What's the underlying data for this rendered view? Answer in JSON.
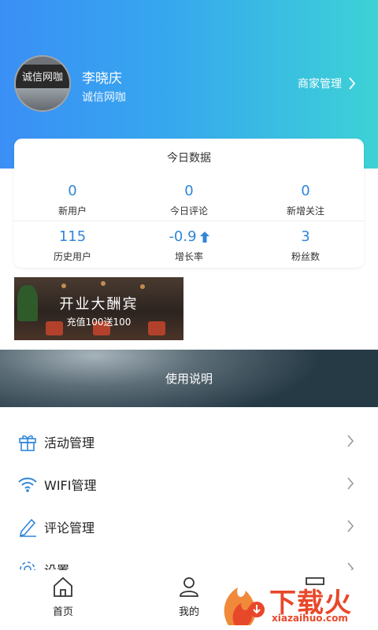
{
  "profile": {
    "name": "李晓庆",
    "shop": "诚信网咖",
    "avatar_sign_text": "诚信网咖",
    "merchant_link": "商家管理"
  },
  "today_data": {
    "title": "今日数据",
    "stats": [
      {
        "value": "0",
        "label": "新用户"
      },
      {
        "value": "0",
        "label": "今日评论"
      },
      {
        "value": "0",
        "label": "新增关注"
      },
      {
        "value": "115",
        "label": "历史用户"
      },
      {
        "value": "-0.9",
        "label": "增长率",
        "icon": "arrow-up-icon"
      },
      {
        "value": "3",
        "label": "粉丝数"
      }
    ]
  },
  "promo": {
    "title": "开业大酬宾",
    "subtitle": "充值100送100"
  },
  "instructions": {
    "label": "使用说明"
  },
  "menu": [
    {
      "label": "活动管理",
      "icon": "gift-icon"
    },
    {
      "label": "WIFI管理",
      "icon": "wifi-icon"
    },
    {
      "label": "评论管理",
      "icon": "pencil-icon"
    },
    {
      "label": "设置",
      "icon": "gear-icon"
    }
  ],
  "bottom_nav": [
    {
      "label": "首页",
      "icon": "home-icon"
    },
    {
      "label": "我的",
      "icon": "person-icon"
    },
    {
      "label": "",
      "icon": "store-icon"
    }
  ],
  "watermark": {
    "brand": "下载火",
    "url": "xiazaihuo.com"
  },
  "colors": {
    "header_start": "#3a8ff5",
    "header_end": "#3dd2d6",
    "stat_value": "#2f86d8",
    "icon_blue": "#2f86d8",
    "watermark": "#e8482a"
  }
}
